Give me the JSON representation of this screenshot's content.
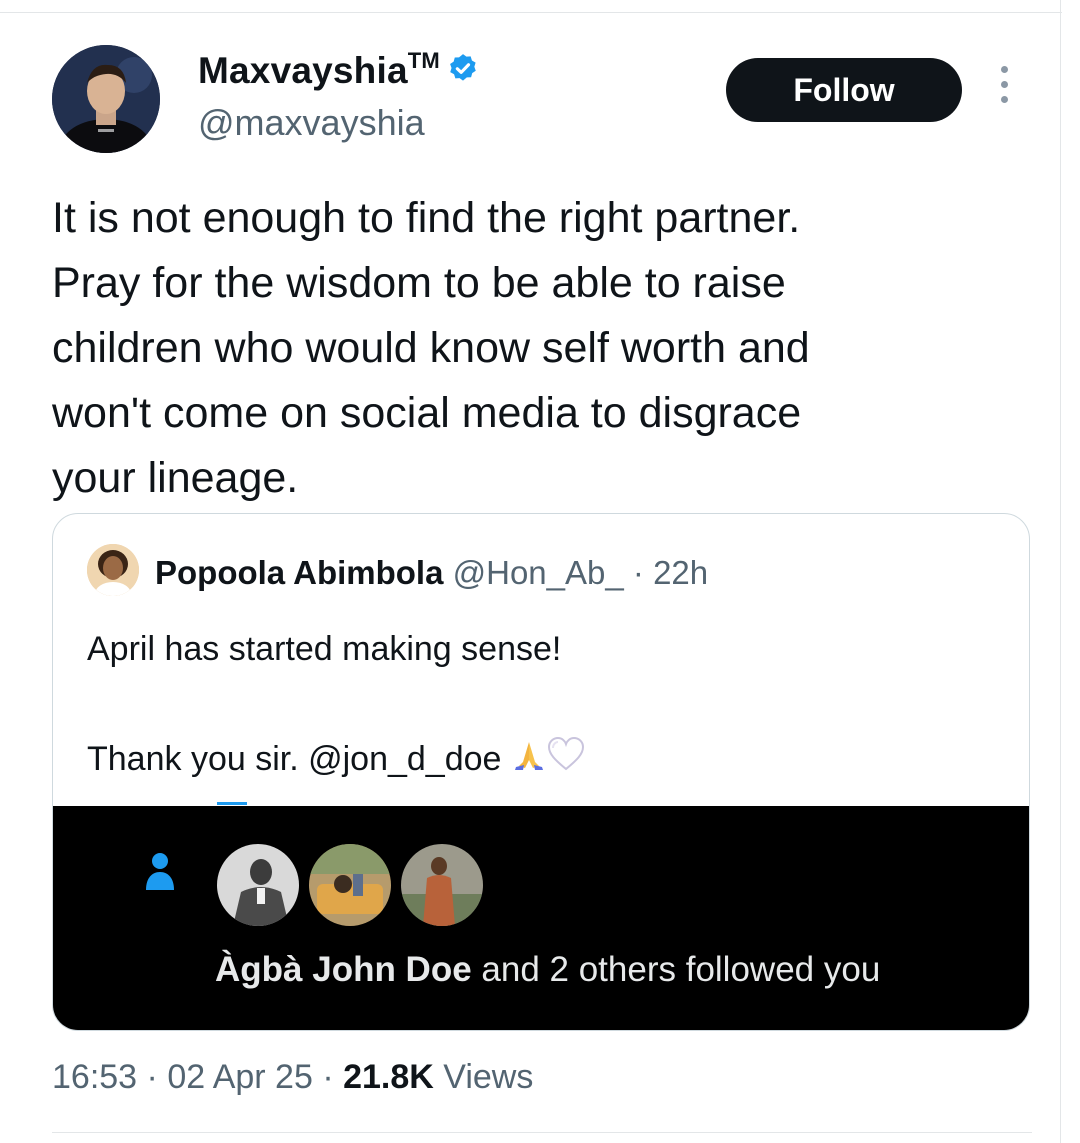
{
  "author": {
    "name": "Maxvayshia",
    "tm": "TM",
    "handle": "@maxvayshia",
    "verified_color": "#1d9bf0"
  },
  "follow_label": "Follow",
  "tweet_text": "It is not enough to find the right partner.\nPray for the wisdom to be able to raise\nchildren who would know self worth and\nwon't come on social media to disgrace\nyour lineage.",
  "quote": {
    "name": "Popoola Abimbola",
    "handle": "@Hon_Ab_",
    "sep": "·",
    "time": "22h",
    "line1": "April has started making sense!",
    "line2": "Thank you sir. @jon_d_doe",
    "emojis": [
      "folded-hands",
      "white-heart"
    ]
  },
  "notification": {
    "name": "Àgbà John Doe",
    "rest": " and 2 others followed you"
  },
  "meta": {
    "time": "16:53",
    "sep1": " · ",
    "date": "02 Apr 25",
    "sep2": " · ",
    "views_count": "21.8K",
    "views_label": " Views"
  },
  "colors": {
    "accent": "#1d9bf0",
    "text": "#0f1419",
    "secondary": "#536471"
  }
}
